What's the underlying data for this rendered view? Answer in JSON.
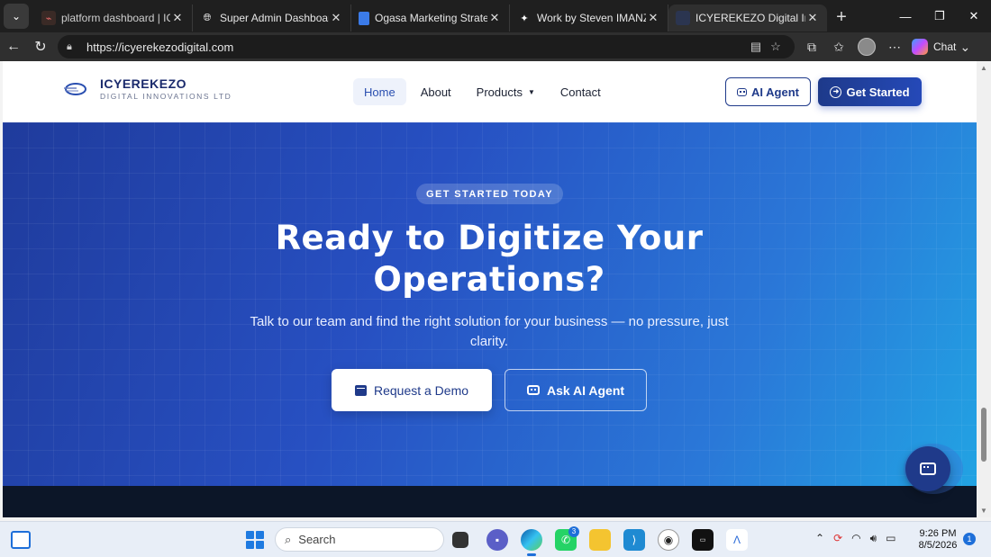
{
  "browser": {
    "tabs": [
      {
        "title": "platform dashboard | ICYEREKEZO",
        "active": false
      },
      {
        "title": "Super Admin Dashboard - ICYEREKEZO",
        "active": false
      },
      {
        "title": "Ogasa Marketing Strategy Plan",
        "active": false
      },
      {
        "title": "Work by Steven IMANZI",
        "active": false
      },
      {
        "title": "ICYEREKEZO Digital Innovations",
        "active": true
      }
    ],
    "url": "https://icyerekezodigital.com",
    "chat_label": "Chat"
  },
  "site": {
    "brand_name": "ICYEREKEZO",
    "brand_tagline": "DIGITAL INNOVATIONS LTD",
    "nav": [
      {
        "label": "Home",
        "active": true
      },
      {
        "label": "About"
      },
      {
        "label": "Products",
        "dropdown": true
      },
      {
        "label": "Contact"
      }
    ],
    "ai_agent_label": "AI Agent",
    "get_started_label": "Get Started"
  },
  "hero": {
    "eyebrow": "GET STARTED TODAY",
    "title_line1": "Ready to Digitize Your",
    "title_line2": "Operations?",
    "subtitle": "Talk to our team and find the right solution for your business — no pressure, just clarity.",
    "primary_cta": "Request a Demo",
    "secondary_cta": "Ask AI Agent"
  },
  "taskbar": {
    "search_placeholder": "Search",
    "whatsapp_badge": "3",
    "time": "9:26 PM",
    "date": "8/5/2026",
    "notification_count": "1"
  },
  "colors": {
    "brand_navy": "#1f3a8a",
    "hero_start": "#1f3b9c",
    "hero_end": "#22a3e3",
    "dark_band": "#0c1628"
  }
}
